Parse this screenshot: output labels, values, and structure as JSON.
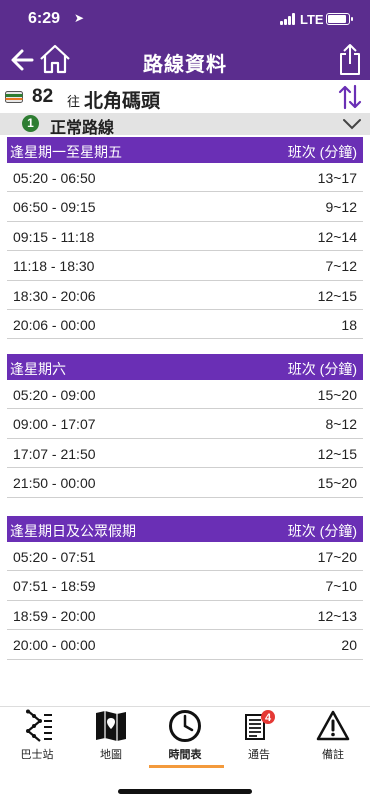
{
  "status": {
    "time": "6:29",
    "network": "LTE"
  },
  "nav": {
    "title": "路線資料"
  },
  "route": {
    "number": "82",
    "to_prefix": "往",
    "destination": "北角碼頭"
  },
  "variant": {
    "index": "1",
    "label": "正常路線"
  },
  "sections": [
    {
      "title": "逢星期一至星期五",
      "freq_label": "班次 (分鐘)",
      "rows": [
        {
          "time": "05:20 - 06:50",
          "freq": "13~17"
        },
        {
          "time": "06:50 - 09:15",
          "freq": "9~12"
        },
        {
          "time": "09:15 - 11:18",
          "freq": "12~14"
        },
        {
          "time": "11:18 - 18:30",
          "freq": "7~12"
        },
        {
          "time": "18:30 - 20:06",
          "freq": "12~15"
        },
        {
          "time": "20:06 - 00:00",
          "freq": "18"
        }
      ]
    },
    {
      "title": "逢星期六",
      "freq_label": "班次 (分鐘)",
      "rows": [
        {
          "time": "05:20 - 09:00",
          "freq": "15~20"
        },
        {
          "time": "09:00 - 17:07",
          "freq": "8~12"
        },
        {
          "time": "17:07 - 21:50",
          "freq": "12~15"
        },
        {
          "time": "21:50 - 00:00",
          "freq": "15~20"
        }
      ]
    },
    {
      "title": "逢星期日及公眾假期",
      "freq_label": "班次 (分鐘)",
      "rows": [
        {
          "time": "05:20 - 07:51",
          "freq": "17~20"
        },
        {
          "time": "07:51 - 18:59",
          "freq": "7~10"
        },
        {
          "time": "18:59 - 20:00",
          "freq": "12~13"
        },
        {
          "time": "20:00 - 00:00",
          "freq": "20"
        }
      ]
    }
  ],
  "tabs": [
    {
      "label": "巴士站",
      "icon": "stops-icon"
    },
    {
      "label": "地圖",
      "icon": "map-icon"
    },
    {
      "label": "時間表",
      "icon": "clock-icon"
    },
    {
      "label": "通告",
      "icon": "notice-icon",
      "badge": "4"
    },
    {
      "label": "備註",
      "icon": "warning-icon"
    }
  ],
  "colors": {
    "header": "#5b2d8e",
    "section_header": "#6a2fb5",
    "active_tab": "#f39a3c",
    "badge_red": "#e53935",
    "variant_green": "#2e7d32"
  }
}
